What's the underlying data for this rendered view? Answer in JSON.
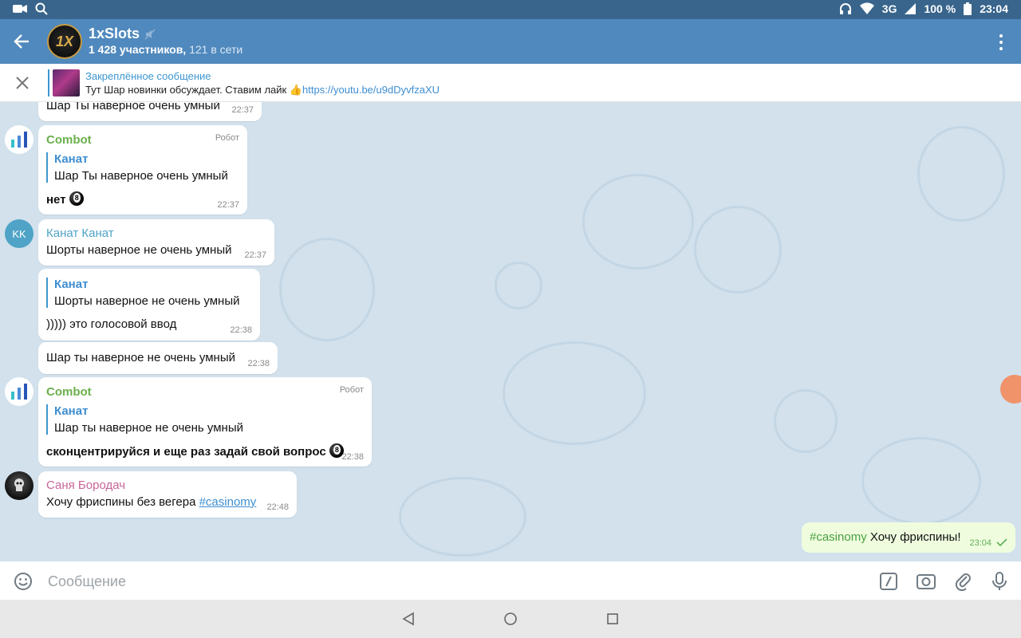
{
  "status_bar": {
    "network": "3G",
    "battery": "100 %",
    "time": "23:04"
  },
  "header": {
    "avatar_text": "1X",
    "title": "1xSlots",
    "members": "1 428 участников,",
    "online": "121 в сети"
  },
  "pinned": {
    "title": "Закреплённое сообщение",
    "text": "Тут Шар новинки обсуждает. Ставим лайк ",
    "emoji": "👍",
    "link": "https://youtu.be/u9dDyvfzaXU"
  },
  "messages": [
    {
      "text": "Шар Ты наверное очень умный",
      "time": "22:37"
    },
    {
      "sender": "Combot",
      "role": "Робот",
      "quote_name": "Канат",
      "quote_text": "Шар Ты наверное очень умный",
      "text": "нет",
      "time": "22:37"
    },
    {
      "avatar": "KK",
      "sender": "Канат Канат",
      "text": "Шорты наверное не очень умный",
      "time": "22:37"
    },
    {
      "quote_name": "Канат",
      "quote_text": "Шорты наверное не очень умный",
      "text": "))))) это голосовой ввод",
      "time": "22:38"
    },
    {
      "text": "Шар ты наверное не очень умный",
      "time": "22:38"
    },
    {
      "sender": "Combot",
      "role": "Робот",
      "quote_name": "Канат",
      "quote_text": "Шар ты наверное не очень умный",
      "text": "сконцентрируйся и еще раз задай свой вопрос",
      "time": "22:38"
    },
    {
      "sender": "Саня Бородач",
      "text": "Хочу фриспины без вегера ",
      "hashtag": "#casinomy",
      "time": "22:48"
    }
  ],
  "own_message": {
    "hashtag": "#casinomy",
    "text": " Хочу фриспины!",
    "time": "23:04"
  },
  "composer": {
    "placeholder": "Сообщение"
  },
  "colors": {
    "header": "#5089bd",
    "statusbar": "#39658c",
    "combot": "#6ab04c",
    "kanat": "#4fa3c7",
    "sanya": "#c76598",
    "link": "#3e8ed1"
  }
}
